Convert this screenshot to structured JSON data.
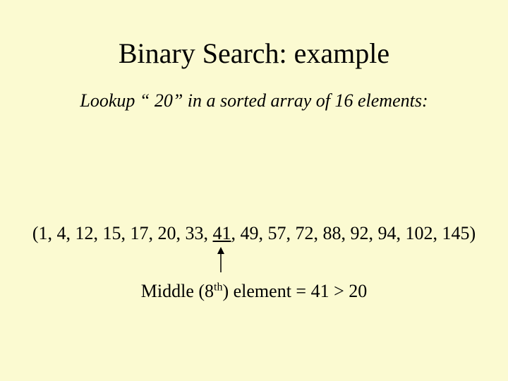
{
  "title": "Binary Search: example",
  "subtitle": "Lookup “ 20” in a sorted array of 16 elements:",
  "array": {
    "open": "(",
    "before": "1, 4, 12, 15, 17, 20, 33, ",
    "mid": "41",
    "after": ", 49, 57, 72, 88, 92, 94, 102, 145",
    "close": ")"
  },
  "middle": {
    "prefix": "Middle (8",
    "sup": "th",
    "suffix": ") element = 41 > 20"
  }
}
